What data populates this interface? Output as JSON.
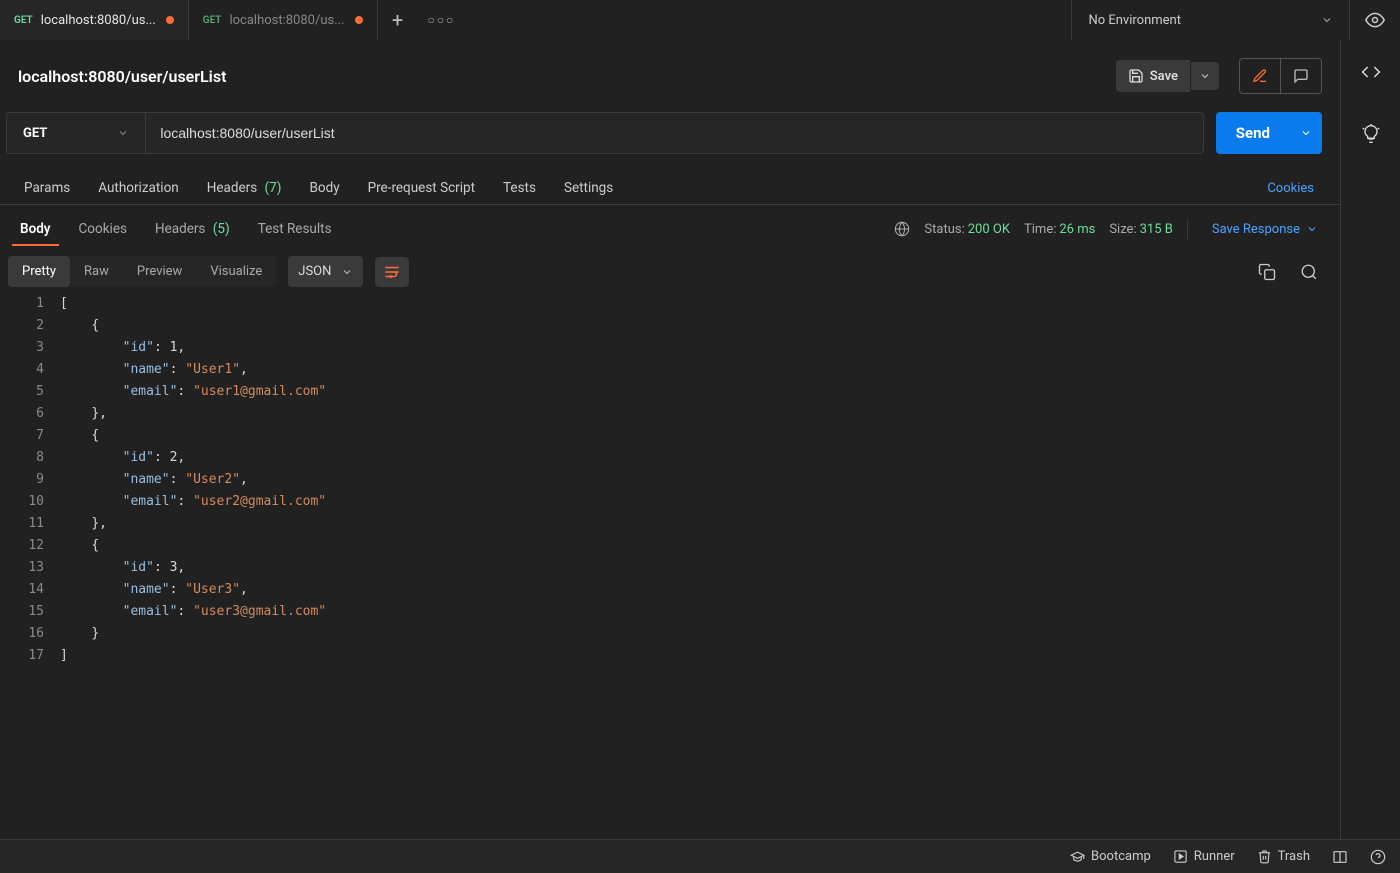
{
  "tabs": [
    {
      "method": "GET",
      "title": "localhost:8080/us...",
      "active": true
    },
    {
      "method": "GET",
      "title": "localhost:8080/us...",
      "active": false
    }
  ],
  "env": {
    "selected": "No Environment"
  },
  "request": {
    "title": "localhost:8080/user/userList",
    "method": "GET",
    "url": "localhost:8080/user/userList",
    "saveLabel": "Save",
    "sendLabel": "Send"
  },
  "reqTabs": {
    "params": "Params",
    "auth": "Authorization",
    "headers": "Headers",
    "headersCount": "(7)",
    "body": "Body",
    "prereq": "Pre-request Script",
    "tests": "Tests",
    "settings": "Settings",
    "cookies": "Cookies"
  },
  "respTabs": {
    "body": "Body",
    "cookies": "Cookies",
    "headers": "Headers",
    "headersCount": "(5)",
    "testResults": "Test Results"
  },
  "respMeta": {
    "statusLabel": "Status:",
    "statusValue": "200 OK",
    "timeLabel": "Time:",
    "timeValue": "26 ms",
    "sizeLabel": "Size:",
    "sizeValue": "315 B",
    "saveResponse": "Save Response"
  },
  "viewModes": {
    "pretty": "Pretty",
    "raw": "Raw",
    "preview": "Preview",
    "visualize": "Visualize",
    "format": "JSON"
  },
  "response": [
    {
      "id": 1,
      "name": "User1",
      "email": "user1@gmail.com"
    },
    {
      "id": 2,
      "name": "User2",
      "email": "user2@gmail.com"
    },
    {
      "id": 3,
      "name": "User3",
      "email": "user3@gmail.com"
    }
  ],
  "statusbar": {
    "bootcamp": "Bootcamp",
    "runner": "Runner",
    "trash": "Trash"
  }
}
